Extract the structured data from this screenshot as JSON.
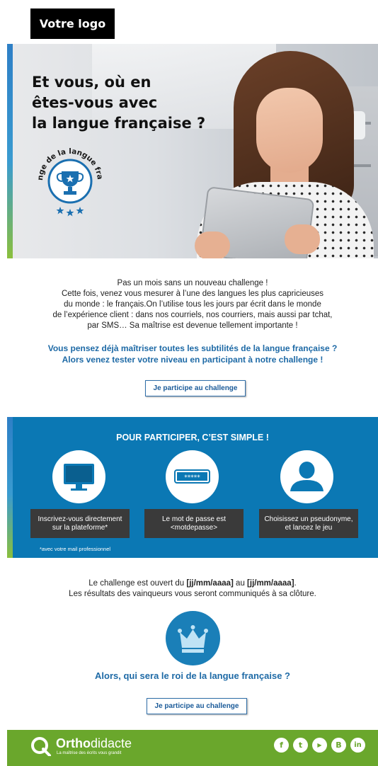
{
  "header": {
    "logo_text": "Votre logo"
  },
  "hero": {
    "title_lines": [
      "Et vous, où en",
      "êtes-vous avec",
      "la langue française ?"
    ],
    "badge_text": "Challenge de la langue française"
  },
  "intro": {
    "lines": [
      "Pas un mois sans un nouveau challenge !",
      "Cette fois, venez vous mesurer à l’une des langues les plus capricieuses",
      "du monde : le français.On l’utilise tous les jours par écrit dans le monde",
      "de l’expérience client : dans nos courriels, nos courriers, mais aussi par tchat,",
      "par SMS… Sa maîtrise est devenue tellement importante !"
    ],
    "highlight_lines": [
      "Vous pensez déjà maîtriser toutes les subtilités de la langue française ?",
      "Alors venez tester votre niveau en participant à notre challenge !"
    ],
    "cta_label": "Je participe au challenge"
  },
  "steps": {
    "title": "POUR PARTICIPER, C’EST SIMPLE !",
    "items": [
      {
        "icon": "monitor-icon",
        "line1": "Inscrivez-vous directement",
        "line2": "sur la plateforme*"
      },
      {
        "icon": "password-icon",
        "line1": "Le mot de passe est",
        "line2": "<motdepasse>",
        "password_mask": "*****"
      },
      {
        "icon": "user-icon",
        "line1": "Choisissez un pseudonyme,",
        "line2": "et lancez le jeu"
      }
    ],
    "footnote": "*avec votre mail professionnel"
  },
  "closing": {
    "line1_prefix": "Le challenge est ouvert du ",
    "date_start": "[jj/mm/aaaa]",
    "line1_mid": " au ",
    "date_end": "[jj/mm/aaaa]",
    "line1_suffix": ".",
    "line2": "Les résultats des vainqueurs vous seront communiqués à sa clôture.",
    "question": "Alors, qui sera le roi de la langue française ?",
    "cta_label": "Je participe au challenge"
  },
  "footer": {
    "brand_bold": "Ortho",
    "brand_regular": "didacte",
    "tagline": "La maîtrise des écrits vous grandit",
    "socials": [
      {
        "name": "facebook-icon",
        "glyph": "f"
      },
      {
        "name": "twitter-icon",
        "glyph": "t"
      },
      {
        "name": "youtube-icon",
        "glyph": "▶"
      },
      {
        "name": "blog-icon",
        "glyph": "B"
      },
      {
        "name": "linkedin-icon",
        "glyph": "in"
      }
    ]
  },
  "colors": {
    "blue": "#0b78b4",
    "accent_blue": "#1e6aa6",
    "green": "#6aa72c",
    "dark": "#3a3a3a"
  }
}
